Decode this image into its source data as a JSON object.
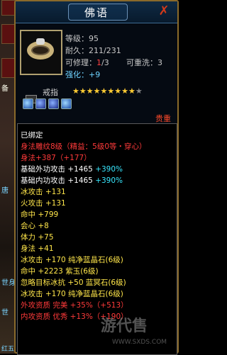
{
  "window": {
    "title": "佛语"
  },
  "left_strip": {
    "labels": [
      "备",
      "唐",
      "世身",
      "世",
      "红五"
    ]
  },
  "item": {
    "level_label": "等级：",
    "level": "95",
    "durability_label": "耐久：",
    "durability": "211/231",
    "repair_label": "可修理：",
    "repair_current": "1",
    "repair_total": "/3",
    "rewash_label": "可重洗：",
    "rewash": "3",
    "enhance_label": "强化：",
    "enhance": "+9",
    "type": "戒指",
    "stars_filled": 9,
    "stars_total": 10,
    "rarity": "贵重"
  },
  "attributes": [
    {
      "text": "已绑定",
      "color": "white"
    },
    {
      "text": "身法雕纹8级（精益：5级0等・穿心）",
      "color": "red"
    },
    {
      "text": "身法+387（+177）",
      "color": "red"
    },
    {
      "text": "基础外功攻击 +1465",
      "extra": "+390%",
      "color": "white"
    },
    {
      "text": "基础内功攻击 +1465",
      "extra": "+390%",
      "color": "white"
    },
    {
      "text": "冰攻击 +131",
      "color": "yellow"
    },
    {
      "text": "火攻击 +131",
      "color": "yellow"
    },
    {
      "text": "命中 +799",
      "color": "yellow"
    },
    {
      "text": "会心 +8",
      "color": "yellow"
    },
    {
      "text": "体力 +75",
      "color": "yellow"
    },
    {
      "text": "身法 +41",
      "color": "yellow"
    },
    {
      "text": "冰攻击 +170 纯净蓝晶石(6级)",
      "color": "yellow"
    },
    {
      "text": "命中 +2223 紫玉(6级)",
      "color": "yellow"
    },
    {
      "text": "忽略目标冰抗 +50 蓝冥石(6级)",
      "color": "yellow"
    },
    {
      "text": "冰攻击 +170 纯净蓝晶石(6级)",
      "color": "yellow"
    },
    {
      "text": "外攻资质 完美 +35%（+513）",
      "color": "red"
    },
    {
      "text": "内攻资质 优秀 +13%（+190）",
      "color": "red"
    }
  ],
  "watermark": {
    "text": "游代售",
    "url": "WWW.SXDS.COM"
  }
}
